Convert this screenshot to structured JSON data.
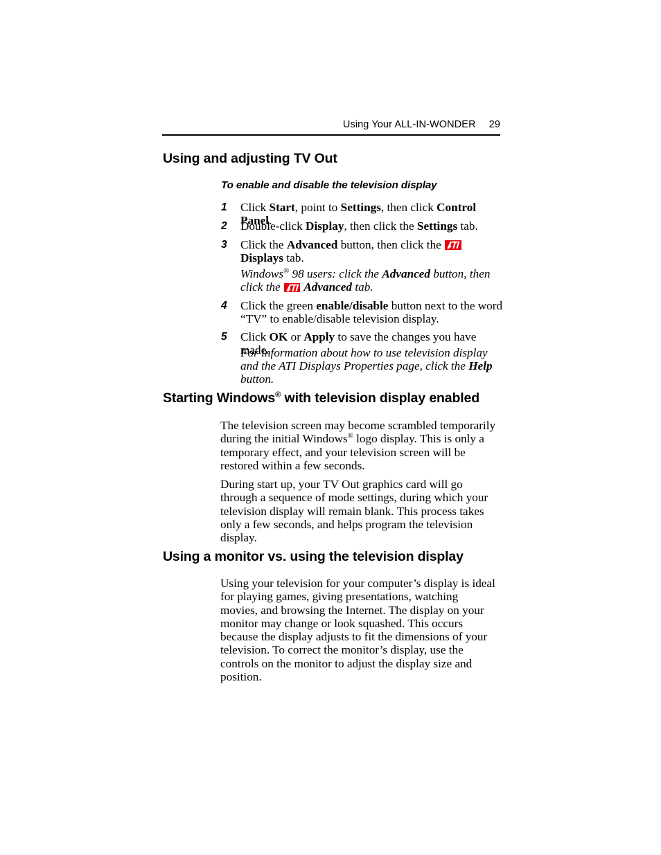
{
  "header": {
    "title": "Using Your ALL-IN-WONDER",
    "page_number": "29"
  },
  "sections": {
    "tv_out": {
      "title": "Using and adjusting TV Out",
      "subhead": "To enable and disable the television display",
      "steps": [
        {
          "number": "1",
          "parts": [
            {
              "text": "Click ",
              "style": "normal"
            },
            {
              "text": "Start",
              "style": "bold"
            },
            {
              "text": ", point to ",
              "style": "normal"
            },
            {
              "text": "Settings",
              "style": "bold"
            },
            {
              "text": ", then click ",
              "style": "normal"
            },
            {
              "text": "Control Panel",
              "style": "bold"
            },
            {
              "text": ".",
              "style": "normal"
            }
          ]
        },
        {
          "number": "2",
          "parts": [
            {
              "text": "Double-click ",
              "style": "normal"
            },
            {
              "text": "Display",
              "style": "bold"
            },
            {
              "text": ", then click the ",
              "style": "normal"
            },
            {
              "text": "Settings",
              "style": "bold"
            },
            {
              "text": " tab.",
              "style": "normal"
            }
          ]
        },
        {
          "number": "3",
          "parts": [
            {
              "text": "Click the ",
              "style": "normal"
            },
            {
              "text": "Advanced",
              "style": "bold"
            },
            {
              "text": " button, then click the ",
              "style": "normal"
            },
            {
              "text": "",
              "style": "logo"
            },
            {
              "text": "Displays",
              "style": "bold"
            },
            {
              "text": " tab.",
              "style": "normal"
            }
          ]
        },
        {
          "number": "4",
          "parts": [
            {
              "text": "Click the green ",
              "style": "normal"
            },
            {
              "text": "enable/disable",
              "style": "bold"
            },
            {
              "text": " button next to the word “TV” to enable/disable television display.",
              "style": "normal"
            }
          ]
        },
        {
          "number": "5",
          "parts": [
            {
              "text": "Click ",
              "style": "normal"
            },
            {
              "text": "OK",
              "style": "bold"
            },
            {
              "text": " or ",
              "style": "normal"
            },
            {
              "text": "Apply",
              "style": "bold"
            },
            {
              "text": " to save the changes you have made.",
              "style": "normal"
            }
          ]
        }
      ],
      "note_win98": [
        {
          "text": "Windows",
          "style": "italic"
        },
        {
          "text": "®",
          "style": "sup"
        },
        {
          "text": " 98 users: click the ",
          "style": "italic"
        },
        {
          "text": "Advanced",
          "style": "bold-italic"
        },
        {
          "text": " button, then click the ",
          "style": "italic"
        },
        {
          "text": "",
          "style": "logo"
        },
        {
          "text": "Advanced",
          "style": "bold-italic"
        },
        {
          "text": " tab.",
          "style": "italic"
        }
      ],
      "note_help": [
        {
          "text": "For information about how to use television display and the ATI Displays Properties page, click the ",
          "style": "italic"
        },
        {
          "text": "Help",
          "style": "bold-italic"
        },
        {
          "text": " button.",
          "style": "italic"
        }
      ]
    },
    "starting_windows": {
      "title_prefix": "Starting Windows",
      "title_sup": "®",
      "title_suffix": " with television display enabled",
      "paragraphs": [
        [
          {
            "text": "The television screen may become scrambled temporarily during the initial Windows",
            "style": "normal"
          },
          {
            "text": "®",
            "style": "sup"
          },
          {
            "text": " logo display. This is only a temporary effect, and your television screen will be restored within a few seconds.",
            "style": "normal"
          }
        ],
        [
          {
            "text": "During start up, your TV Out graphics card will go through a sequence of mode settings, during which your television display will remain blank. This process takes only a few seconds, and helps program the television display.",
            "style": "normal"
          }
        ]
      ]
    },
    "monitor_vs_tv": {
      "title": "Using a monitor vs. using the television display",
      "paragraphs": [
        [
          {
            "text": "Using your television for your computer’s display is ideal for playing games, giving presentations, watching movies, and browsing the Internet.  The display on your monitor may change or look squashed.  This occurs because the display adjusts to fit the dimensions of your television.  To correct the monitor’s display, use the controls on the monitor to adjust the display size and position.",
            "style": "normal"
          }
        ]
      ]
    }
  },
  "icons": {
    "ati_logo_label": "ATI",
    "ati_logo_color": "#e8000d",
    "ati_logo_text_color": "#ffffff"
  }
}
